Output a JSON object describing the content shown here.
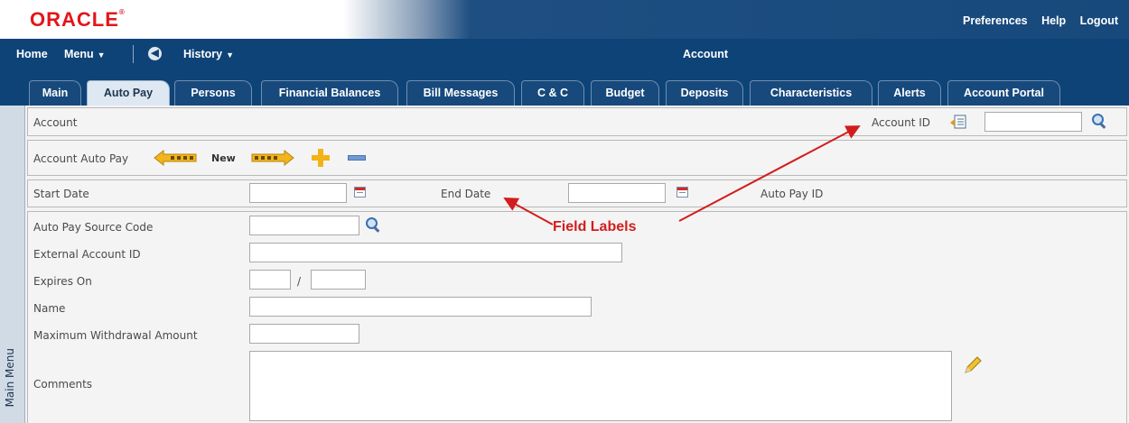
{
  "brand": {
    "logo_text": "ORACLE"
  },
  "header_links": [
    "Preferences",
    "Help",
    "Logout"
  ],
  "nav": {
    "home": "Home",
    "menu": "Menu",
    "history": "History",
    "page_title": "Account"
  },
  "tabs": [
    "Main",
    "Auto Pay",
    "Persons",
    "Financial Balances",
    "Bill Messages",
    "C & C",
    "Budget",
    "Deposits",
    "Characteristics",
    "Alerts",
    "Account Portal"
  ],
  "active_tab": "Auto Pay",
  "sidebar": {
    "label": "Main Menu"
  },
  "account_section": {
    "label": "Account",
    "account_id_label": "Account ID",
    "account_id_value": ""
  },
  "autopay_section": {
    "label": "Account Auto Pay",
    "new_label": "New"
  },
  "dates": {
    "start_date_label": "Start Date",
    "start_date_value": "",
    "end_date_label": "End Date",
    "end_date_value": "",
    "auto_pay_id_label": "Auto Pay ID"
  },
  "fields": {
    "source_code_label": "Auto Pay Source Code",
    "external_account_label": "External Account ID",
    "expires_label": "Expires On",
    "expires_sep": "/",
    "name_label": "Name",
    "max_withdrawal_label": "Maximum Withdrawal Amount",
    "comments_label": "Comments"
  },
  "annotation": {
    "text": "Field Labels",
    "color": "#d31d1d"
  },
  "colors": {
    "nav_bg": "#0e4378",
    "oracle_red": "#e2161b",
    "active_tab": "#dde8f2"
  }
}
